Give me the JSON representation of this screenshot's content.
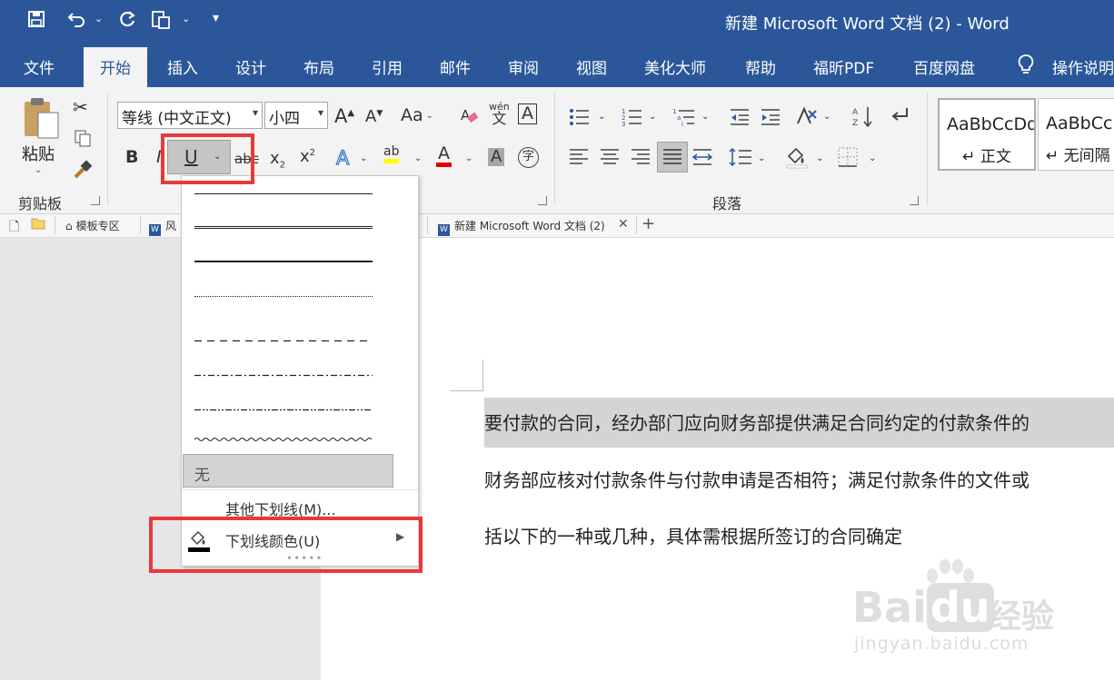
{
  "window": {
    "title": "新建 Microsoft Word 文档 (2)  -  Word"
  },
  "menu_tabs": [
    {
      "label": "文件"
    },
    {
      "label": "开始"
    },
    {
      "label": "插入"
    },
    {
      "label": "设计"
    },
    {
      "label": "布局"
    },
    {
      "label": "引用"
    },
    {
      "label": "邮件"
    },
    {
      "label": "审阅"
    },
    {
      "label": "视图"
    },
    {
      "label": "美化大师"
    },
    {
      "label": "帮助"
    },
    {
      "label": "福昕PDF"
    },
    {
      "label": "百度网盘"
    },
    {
      "label": "操作说明"
    }
  ],
  "ribbon": {
    "clipboard": {
      "paste_label": "粘贴",
      "group_label": "剪贴板"
    },
    "font": {
      "font_name": "等线 (中文正文)",
      "font_size": "小四",
      "clear_char": "Aa",
      "pinyin_char": "wén",
      "pinyin_sub": "文",
      "border_char": "A",
      "bold": "B",
      "italic": "I",
      "underline": "U",
      "strike": "abc",
      "sub_x": "x",
      "sub_2": "2",
      "sup_x": "x",
      "sup_2": "2",
      "effects": "A",
      "highlight": "ab",
      "fontcolor": "A",
      "shading": "A",
      "enclose": "字"
    },
    "paragraph": {
      "group_label": "段落"
    },
    "styles": [
      {
        "preview": "AaBbCcDd",
        "name": "正文"
      },
      {
        "preview": "AaBbCcD",
        "name": "无间隔"
      }
    ]
  },
  "doc_tabs": [
    {
      "label": "模板专区"
    },
    {
      "label": "风"
    },
    {
      "label": "新建 Microsoft Word 文档 (2)"
    }
  ],
  "dropdown": {
    "none_label": "无",
    "more_label": "其他下划线(M)...",
    "color_label": "下划线颜色(U)"
  },
  "document": {
    "lines": [
      "要付款的合同，经办部门应向财务部提供满足合同约定的付款条件的",
      "财务部应核对付款条件与付款申请是否相符；满足付款条件的文件或",
      "括以下的一种或几种，具体需根据所签订的合同确定"
    ]
  },
  "watermark": {
    "brand": "Bai",
    "brand2": "du",
    "cn": "经验",
    "url": "jingyan.baidu.com"
  },
  "colors": {
    "title_bar": "#2b579a",
    "highlight_box": "#e8393a",
    "text_highlight": "#ffff00",
    "font_color": "#e00000"
  }
}
